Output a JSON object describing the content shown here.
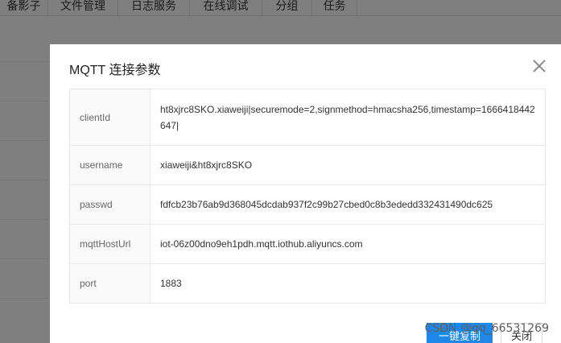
{
  "background": {
    "tabs": [
      "备影子",
      "文件管理",
      "日志服务",
      "在线调试",
      "分组",
      "任务"
    ]
  },
  "dialog": {
    "title": "MQTT 连接参数",
    "rows": [
      {
        "key": "clientId",
        "value": "ht8xjrc8SKO.xiaweiji|securemode=2,signmethod=hmacsha256,timestamp=1666418442647|"
      },
      {
        "key": "username",
        "value": "xiaweiji&ht8xjrc8SKO"
      },
      {
        "key": "passwd",
        "value": "fdfcb23b76ab9d368045dcdab937f2c99b27cbed0c8b3ededd332431490dc625"
      },
      {
        "key": "mqttHostUrl",
        "value": "iot-06z00dno9eh1pdh.mqtt.iothub.aliyuncs.com"
      },
      {
        "key": "port",
        "value": "1883"
      }
    ],
    "copy_label": "一键复制",
    "close_label": "关闭"
  },
  "watermark": "CSDN @qq_66531269"
}
